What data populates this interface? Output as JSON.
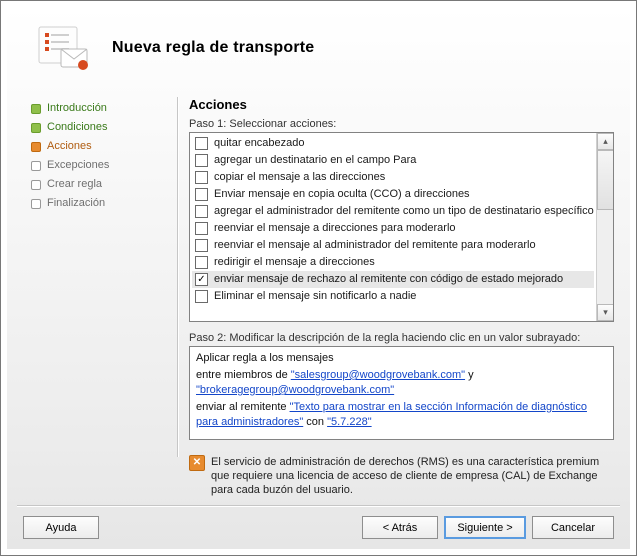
{
  "header": {
    "title": "Nueva regla de transporte"
  },
  "sidebar": {
    "items": [
      {
        "label": "Introducción",
        "state": "done"
      },
      {
        "label": "Condiciones",
        "state": "done"
      },
      {
        "label": "Acciones",
        "state": "active"
      },
      {
        "label": "Excepciones",
        "state": "pending"
      },
      {
        "label": "Crear regla",
        "state": "pending"
      },
      {
        "label": "Finalización",
        "state": "pending"
      }
    ]
  },
  "main": {
    "section_title": "Acciones",
    "step1_label": "Paso 1: Seleccionar acciones:",
    "actions": [
      {
        "label": "quitar encabezado",
        "checked": false,
        "selected": false
      },
      {
        "label": "agregar un destinatario en el campo Para",
        "checked": false,
        "selected": false
      },
      {
        "label": "copiar el mensaje a las direcciones",
        "checked": false,
        "selected": false
      },
      {
        "label": "Enviar mensaje en copia oculta (CCO) a direcciones",
        "checked": false,
        "selected": false
      },
      {
        "label": "agregar el administrador del remitente como un tipo de destinatario específico",
        "checked": false,
        "selected": false
      },
      {
        "label": "reenviar el mensaje a direcciones para moderarlo",
        "checked": false,
        "selected": false
      },
      {
        "label": "reenviar el mensaje al administrador del remitente para moderarlo",
        "checked": false,
        "selected": false
      },
      {
        "label": "redirigir el mensaje a direcciones",
        "checked": false,
        "selected": false
      },
      {
        "label": "enviar mensaje de rechazo al remitente con código de estado mejorado",
        "checked": true,
        "selected": true
      },
      {
        "label": "Eliminar el mensaje sin notificarlo a nadie",
        "checked": false,
        "selected": false
      }
    ],
    "step2_label": "Paso 2: Modificar la descripción de la regla haciendo clic en un valor subrayado:",
    "description": {
      "line1": "Aplicar regla a los mensajes",
      "line2_pre": "entre miembros de ",
      "line2_link1": "\"salesgroup@woodgrovebank.com\"",
      "line2_mid": " y ",
      "line2_link2": "\"brokeragegroup@woodgrovebank.com\"",
      "line3_pre": "enviar al remitente ",
      "line3_link1": "\"Texto para mostrar en la sección Información de diagnóstico para administradores\"",
      "line3_mid": " con ",
      "line3_link2": "\"5.7.228\""
    }
  },
  "notice": {
    "text": "El servicio de administración de derechos (RMS) es una característica premium que requiere una licencia de acceso de cliente de empresa (CAL) de Exchange para cada buzón del usuario."
  },
  "buttons": {
    "help": "Ayuda",
    "back": "< Atrás",
    "next": "Siguiente >",
    "cancel": "Cancelar"
  }
}
